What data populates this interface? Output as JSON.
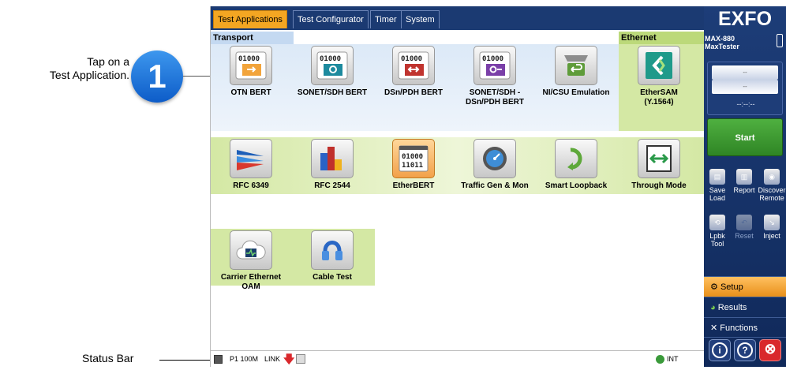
{
  "callouts": {
    "step_number": "1",
    "tap_line1": "Tap on a",
    "tap_line2": "Test Application.",
    "status_bar": "Status Bar"
  },
  "tabs": [
    {
      "label": "Test Applications",
      "active": true
    },
    {
      "label": "Test Configurator",
      "active": false
    },
    {
      "label": "Timer",
      "active": false
    },
    {
      "label": "System",
      "active": false
    }
  ],
  "sections": {
    "transport": "Transport",
    "ethernet": "Ethernet"
  },
  "apps": [
    {
      "label": "OTN BERT",
      "icon": "otn-bert-icon"
    },
    {
      "label": "SONET/SDH BERT",
      "icon": "sonet-sdh-bert-icon"
    },
    {
      "label": "DSn/PDH BERT",
      "icon": "dsn-pdh-bert-icon"
    },
    {
      "label": "SONET/SDH -\nDSn/PDH BERT",
      "icon": "sonet-dsn-bert-icon"
    },
    {
      "label": "NI/CSU Emulation",
      "icon": "ni-csu-emulation-icon"
    },
    {
      "label": "EtherSAM\n(Y.1564)",
      "icon": "ethersam-icon"
    },
    {
      "label": "RFC 6349",
      "icon": "rfc-6349-icon"
    },
    {
      "label": "RFC 2544",
      "icon": "rfc-2544-icon"
    },
    {
      "label": "EtherBERT",
      "icon": "etherbert-icon",
      "selected": true
    },
    {
      "label": "Traffic Gen & Mon",
      "icon": "traffic-gen-mon-icon"
    },
    {
      "label": "Smart Loopback",
      "icon": "smart-loopback-icon"
    },
    {
      "label": "Through Mode",
      "icon": "through-mode-icon"
    },
    {
      "label": "Carrier Ethernet\nOAM",
      "icon": "carrier-ethernet-oam-icon"
    },
    {
      "label": "Cable Test",
      "icon": "cable-test-icon"
    }
  ],
  "binary": {
    "line1": "01000",
    "line2": "11011"
  },
  "status": {
    "port": "P1 100M",
    "link": "LINK",
    "clock": "INT"
  },
  "panel": {
    "logo": "EXFO",
    "model_line1": "MAX-880",
    "model_line2": "MaxTester",
    "value1": "--",
    "value2": "--",
    "timer": "--:--:--",
    "start": "Start",
    "tools": [
      {
        "label": "Save\nLoad",
        "icon": "save-load-icon",
        "enabled": true
      },
      {
        "label": "Report",
        "icon": "report-icon",
        "enabled": true
      },
      {
        "label": "Discover\nRemote",
        "icon": "discover-remote-icon",
        "enabled": true
      },
      {
        "label": "Lpbk\nTool",
        "icon": "loopback-tool-icon",
        "enabled": true
      },
      {
        "label": "Reset",
        "icon": "reset-icon",
        "enabled": false
      },
      {
        "label": "Inject",
        "icon": "inject-icon",
        "enabled": true
      }
    ],
    "nav": [
      {
        "label": "Setup",
        "icon": "gear-icon",
        "active": true
      },
      {
        "label": "Results",
        "icon": "pie-chart-icon",
        "active": false
      },
      {
        "label": "Functions",
        "icon": "tools-icon",
        "active": false
      }
    ],
    "bottom": {
      "info": "i",
      "help": "?",
      "close": "⊗"
    }
  },
  "colors": {
    "tab_active": "#f4a622",
    "panel": "#1b3a72",
    "transport_band": "#dce9f7",
    "ethernet_band": "#d4e8a4",
    "start": "#3b9a2f",
    "setup_active": "#f0a030",
    "close": "#d9282c"
  }
}
